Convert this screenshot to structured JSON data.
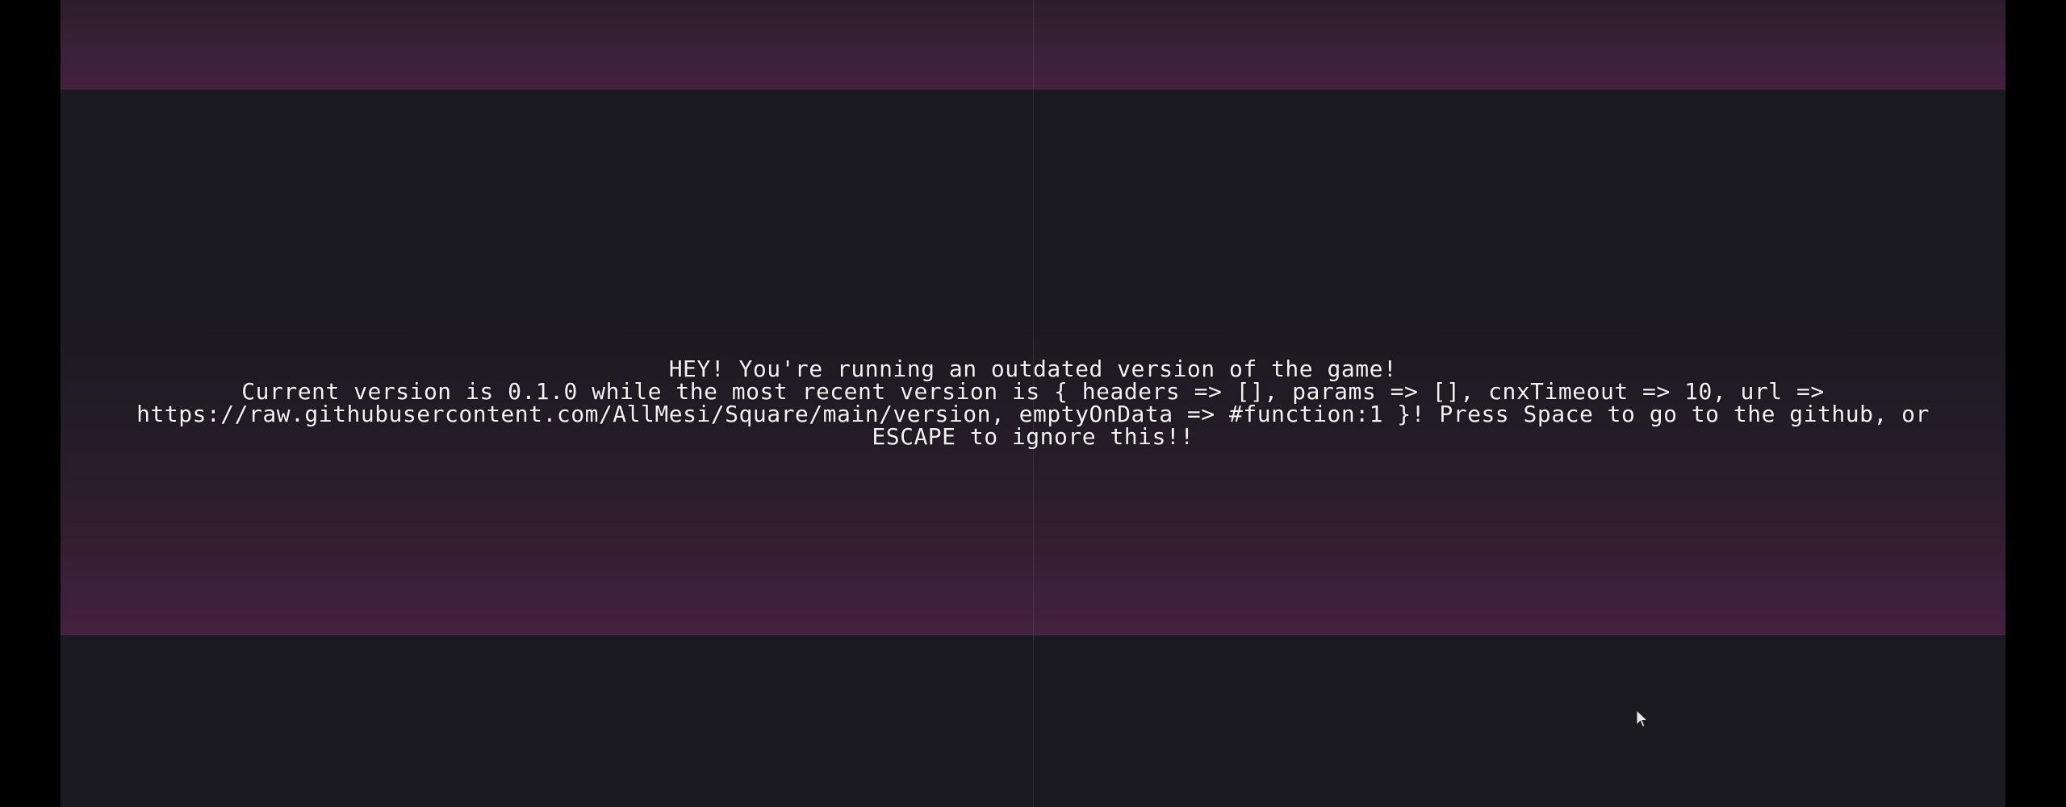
{
  "update_notice": {
    "title": "HEY! You're running an outdated version of the game!",
    "line1": "Current version is 0.1.0 while the most recent version is { headers => [], params => [], cnxTimeout => 10, url =>",
    "line2": "https://raw.githubusercontent.com/AllMesi/Square/main/version, emptyOnData => #function:1 }! Press Space to go to the github, or",
    "line3": "ESCAPE to ignore this!!"
  },
  "colors": {
    "background": "#1b1a20",
    "band_accent": "#452140",
    "text": "#f2f2f2"
  },
  "icons": {
    "cursor": "mouse-pointer-icon"
  }
}
